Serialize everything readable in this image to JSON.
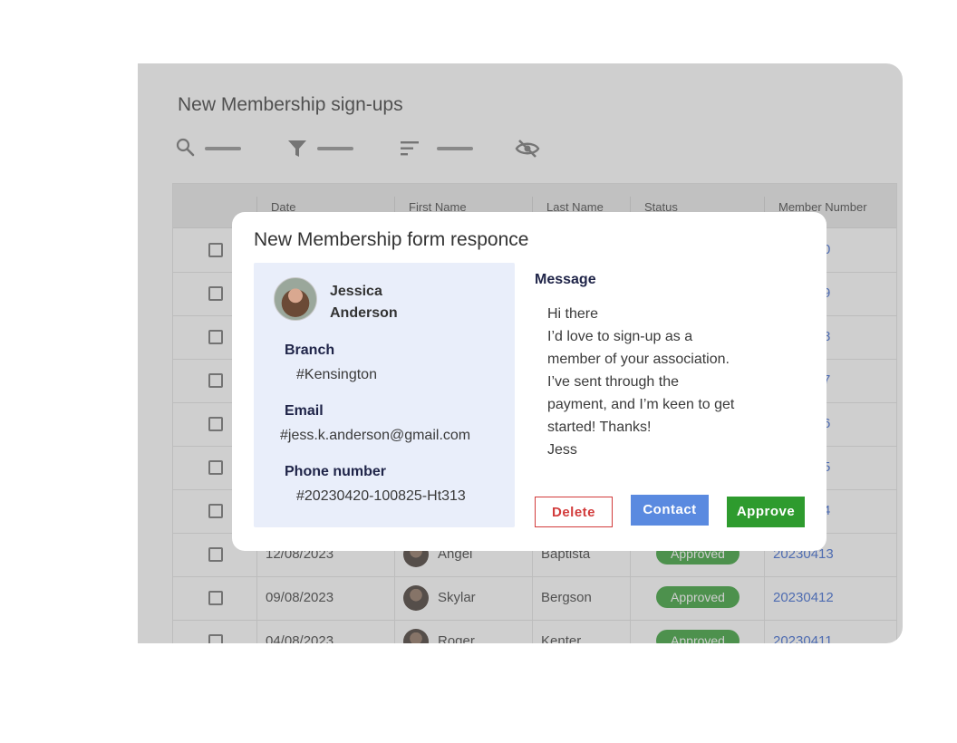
{
  "background": {
    "title": "New Membership sign-ups",
    "toolbar": [
      {
        "icon": "search-icon"
      },
      {
        "icon": "filter-icon"
      },
      {
        "icon": "sort-icon"
      },
      {
        "icon": "eye-off-icon"
      }
    ],
    "columns": [
      "Date",
      "First Name",
      "Last Name",
      "Status",
      "Member Number"
    ],
    "hidden_member_suffixes": [
      "0",
      "9",
      "8",
      "7",
      "6",
      "5",
      "4"
    ],
    "rows": [
      {
        "date": "12/08/2023",
        "first": "Angel",
        "last": "Baptista",
        "status": "Approved",
        "member": "20230413"
      },
      {
        "date": "09/08/2023",
        "first": "Skylar",
        "last": "Bergson",
        "status": "Approved",
        "member": "20230412"
      },
      {
        "date": "04/08/2023",
        "first": "Roger",
        "last": "Kenter",
        "status": "Approved",
        "member": "20230411"
      }
    ]
  },
  "modal": {
    "title": "New Membership form responce",
    "name_first": "Jessica",
    "name_last": "Anderson",
    "branch_label": "Branch",
    "branch_value": "#Kensington",
    "email_label": "Email",
    "email_value": "#jess.k.anderson@gmail.com",
    "phone_label": "Phone number",
    "phone_value": "#20230420-100825-Ht313",
    "message_label": "Message",
    "message_lines": [
      "Hi there",
      "I’d love to sign-up as a",
      "member of your association.",
      "I’ve sent through the",
      "payment, and I’m keen to get",
      "started! Thanks!",
      "Jess"
    ],
    "delete_label": "Delete",
    "contact_label": "Contact",
    "approve_label": "Approve"
  },
  "colors": {
    "approve": "#2e9b2e",
    "contact": "#5a8ae0",
    "delete": "#d23b3b",
    "link": "#2f5fcf",
    "info_panel": "#e9eefa"
  }
}
